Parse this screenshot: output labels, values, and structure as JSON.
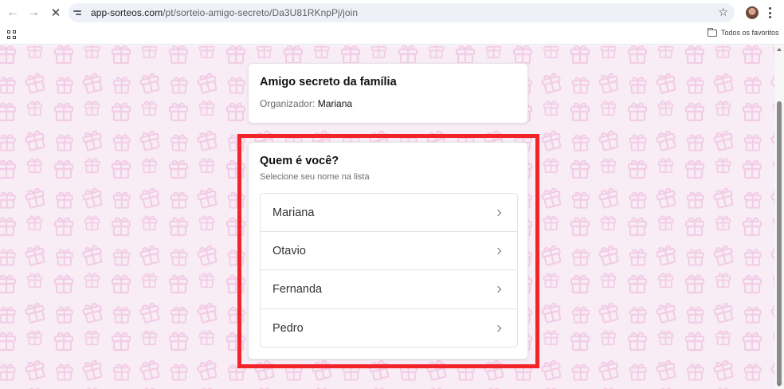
{
  "browser": {
    "url_host": "app-sorteos.com",
    "url_path": "/pt/sorteio-amigo-secreto/Da3U81RKnpPj/join",
    "bookmarks_folder": "Todos os favoritos",
    "icons": [
      "back-arrow-icon",
      "forward-arrow-icon",
      "stop-loading-icon",
      "site-info-icon",
      "star-icon",
      "profile-avatar",
      "menu-icon",
      "apps-icon",
      "folder-icon"
    ]
  },
  "event": {
    "title": "Amigo secreto da família",
    "organizer_label": "Organizador:",
    "organizer_name": "Mariana"
  },
  "participants": {
    "title": "Quem é você?",
    "subtitle": "Selecione seu nome na lista",
    "items": [
      {
        "label": "Mariana"
      },
      {
        "label": "Otavio"
      },
      {
        "label": "Fernanda"
      },
      {
        "label": "Pedro"
      }
    ]
  },
  "colors": {
    "background": "#f8ecf5",
    "gift_pattern": "#f2cde6",
    "highlight_border": "#f3232a",
    "card": "#ffffff"
  }
}
